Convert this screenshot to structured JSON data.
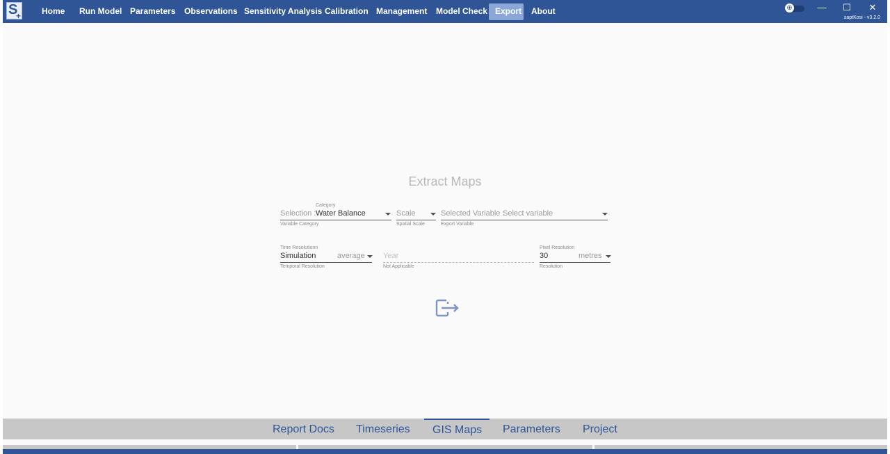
{
  "app": {
    "logo_letter": "S",
    "logo_plus": "+",
    "version": "saptKosi  - v3.2.0",
    "colors": {
      "brand": "#2f5597",
      "active_tab": "#8aa7d8",
      "tab_bar": "#c7c7c7"
    }
  },
  "menu": {
    "items": [
      {
        "label": "Home"
      },
      {
        "label": "Run Model"
      },
      {
        "label": "Parameters"
      },
      {
        "label": "Observations"
      },
      {
        "label": "Sensitivity Analysis"
      },
      {
        "label": "Calibration"
      },
      {
        "label": "Management"
      },
      {
        "label": "Model Check"
      },
      {
        "label": "Export",
        "active": true
      },
      {
        "label": "About"
      }
    ]
  },
  "window_controls": {
    "minimize": "—",
    "maximize": "☐",
    "close": "✕",
    "theme_icon": "theme-toggle-icon"
  },
  "form": {
    "title": "Extract Maps",
    "category": {
      "prefix": "Selection :",
      "label": "Category",
      "value": "Water Balance",
      "helper": "Variable Category"
    },
    "scale": {
      "placeholder": "Scale",
      "helper": "Spatial Scale"
    },
    "variable": {
      "prefix": "Selected Variable :",
      "placeholder": "Select variable",
      "helper": "Export Variable"
    },
    "time_resolution": {
      "label": "Time Resolutionn",
      "value": "Simulation",
      "aggregate": "average",
      "helper": "Temporal Resolution"
    },
    "year": {
      "placeholder": "Year",
      "helper": "Not Applicable"
    },
    "pixel_resolution": {
      "label": "Pixel Resolution",
      "value": "30",
      "unit": "metres",
      "helper": "Resolution"
    },
    "export_icon": "export-icon"
  },
  "bottom_tabs": [
    {
      "label": "Report Docs"
    },
    {
      "label": "Timeseries"
    },
    {
      "label": "GIS Maps",
      "active": true
    },
    {
      "label": "Parameters"
    },
    {
      "label": "Project"
    }
  ]
}
